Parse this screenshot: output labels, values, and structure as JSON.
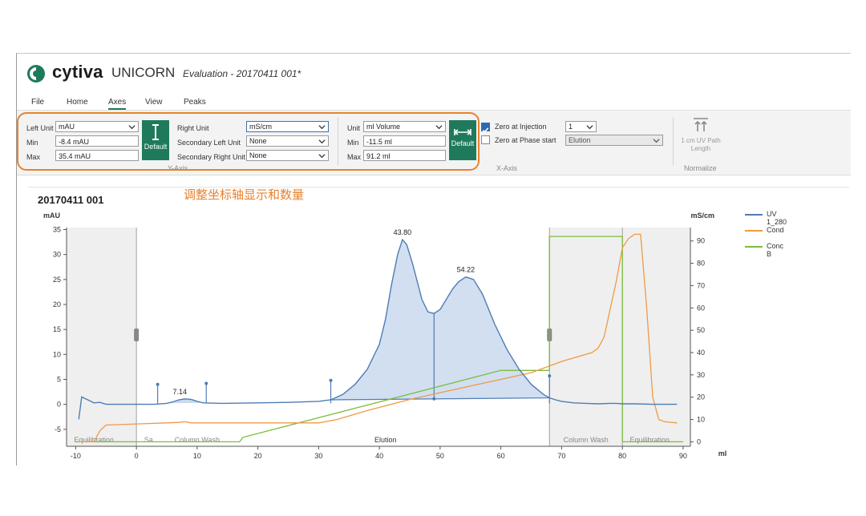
{
  "app": {
    "brand": "cytiva",
    "product": "UNICORN",
    "document_title": "Evaluation - 20170411 001*"
  },
  "menu": [
    "File",
    "Home",
    "Axes",
    "View",
    "Peaks"
  ],
  "menu_active": "Axes",
  "yaxis_group": {
    "left_unit_label": "Left Unit",
    "left_unit_value": "mAU",
    "min_label": "Min",
    "min_value": "-8.4 mAU",
    "max_label": "Max",
    "max_value": "35.4 mAU",
    "default_label": "Default",
    "right_unit_label": "Right Unit",
    "right_unit_value": "mS/cm",
    "secondary_left_label": "Secondary Left Unit",
    "secondary_left_value": "None",
    "secondary_right_label": "Secondary Right Unit",
    "secondary_right_value": "None",
    "group_label": "Y-Axis"
  },
  "xaxis_group": {
    "unit_label": "Unit",
    "unit_value": "ml Volume",
    "min_label": "Min",
    "min_value": "-11.5 ml",
    "max_label": "Max",
    "max_value": "91.2 ml",
    "default_label": "Default",
    "zero_injection_label": "Zero at Injection",
    "zero_injection_checked": true,
    "zero_injection_value": "1",
    "zero_phase_label": "Zero at Phase start",
    "zero_phase_checked": false,
    "zero_phase_value": "Elution",
    "group_label": "X-Axis"
  },
  "normalize_group": {
    "button_label_1": "1 cm UV Path",
    "button_label_2": "Length",
    "group_label": "Normalize"
  },
  "annotation": "调整坐标轴显示和数量",
  "colors": {
    "accent_green": "#1f7a5c",
    "highlight_orange": "#e8822c",
    "uv": "#4f7cb4",
    "cond": "#ef9a45",
    "concb": "#7bbd3a"
  },
  "chart_data": {
    "type": "line",
    "title": "20170411 001",
    "x_unit": "ml",
    "y_left_unit": "mAU",
    "y_right_unit": "mS/cm",
    "xlim": [
      -11.5,
      91.2
    ],
    "ylim_left": [
      -8.4,
      35.4
    ],
    "ylim_right": [
      -2,
      96
    ],
    "x_ticks": [
      -10,
      0,
      10,
      20,
      30,
      40,
      50,
      60,
      70,
      80,
      90
    ],
    "y_left_ticks": [
      -5,
      0,
      5,
      10,
      15,
      20,
      25,
      30,
      35
    ],
    "y_right_ticks": [
      0,
      10,
      20,
      30,
      40,
      50,
      60,
      70,
      80,
      90
    ],
    "grid": false,
    "legend_placement": "right",
    "series": [
      {
        "name": "UV 1_280",
        "axis": "left",
        "x": [
          -9.5,
          -9,
          -8.5,
          -8,
          -7,
          -6,
          -5,
          -3,
          0,
          3,
          5,
          6,
          7,
          8,
          9,
          10,
          11,
          14,
          20,
          25,
          30,
          32,
          34,
          36,
          38,
          40,
          41,
          42,
          43,
          43.8,
          44.5,
          45.5,
          47,
          48,
          49,
          50,
          51,
          52,
          53,
          54.22,
          55.5,
          57,
          59,
          61,
          63,
          65,
          67,
          68,
          69,
          70,
          72,
          74,
          76,
          78,
          79,
          80,
          82,
          85,
          89
        ],
        "y": [
          -3,
          1.5,
          1.2,
          0.9,
          0.3,
          0.4,
          0,
          0,
          0,
          0,
          0.2,
          0.5,
          0.9,
          1.1,
          1.0,
          0.6,
          0.3,
          0.2,
          0.3,
          0.4,
          0.6,
          0.9,
          2,
          4,
          7,
          12,
          17,
          24,
          30,
          33,
          32,
          28,
          21,
          18.5,
          18.2,
          19,
          21,
          23,
          24.5,
          25.5,
          25,
          22,
          16,
          11,
          7,
          4,
          2,
          1.3,
          0.9,
          0.6,
          0.3,
          0.2,
          0.1,
          0.2,
          0.2,
          0.1,
          0.1,
          0,
          0
        ]
      },
      {
        "name": "Cond",
        "axis": "right",
        "x": [
          -9.5,
          -7,
          -6,
          -5,
          0,
          5,
          7,
          8,
          9,
          10,
          20,
          30,
          33,
          38,
          45,
          55,
          65,
          70,
          75,
          76,
          77,
          79,
          80,
          81,
          82,
          83,
          84,
          85,
          86,
          87,
          89
        ],
        "y": [
          0,
          0,
          5,
          7.5,
          8,
          8.5,
          8.7,
          9,
          8.5,
          8.5,
          8.5,
          8.5,
          10,
          14,
          19,
          25,
          31,
          36,
          40,
          42,
          47,
          72,
          87,
          91,
          93,
          93,
          60,
          20,
          10,
          9,
          8.5
        ]
      },
      {
        "name": "Conc B",
        "axis": "right",
        "x": [
          -10,
          0,
          17,
          17.5,
          60,
          68,
          68,
          80,
          80,
          90
        ],
        "y": [
          0,
          0,
          0,
          2,
          32,
          32,
          92,
          92,
          0,
          0
        ]
      }
    ],
    "peak_labels": [
      {
        "x": 7.14,
        "y": 1.1,
        "label": "7.14"
      },
      {
        "x": 43.8,
        "y": 33,
        "label": "43.80"
      },
      {
        "x": 54.22,
        "y": 25.5,
        "label": "54.22"
      }
    ],
    "phases": [
      {
        "label": "Equilibration",
        "x": -7.0
      },
      {
        "label": "Sa...",
        "x": 2.5
      },
      {
        "label": "Column Wash",
        "x": 10.0
      },
      {
        "label": "Elution",
        "x": 41.0
      },
      {
        "label": "Column Wash",
        "x": 74.0
      },
      {
        "label": "Equilibration",
        "x": 84.5
      }
    ]
  }
}
